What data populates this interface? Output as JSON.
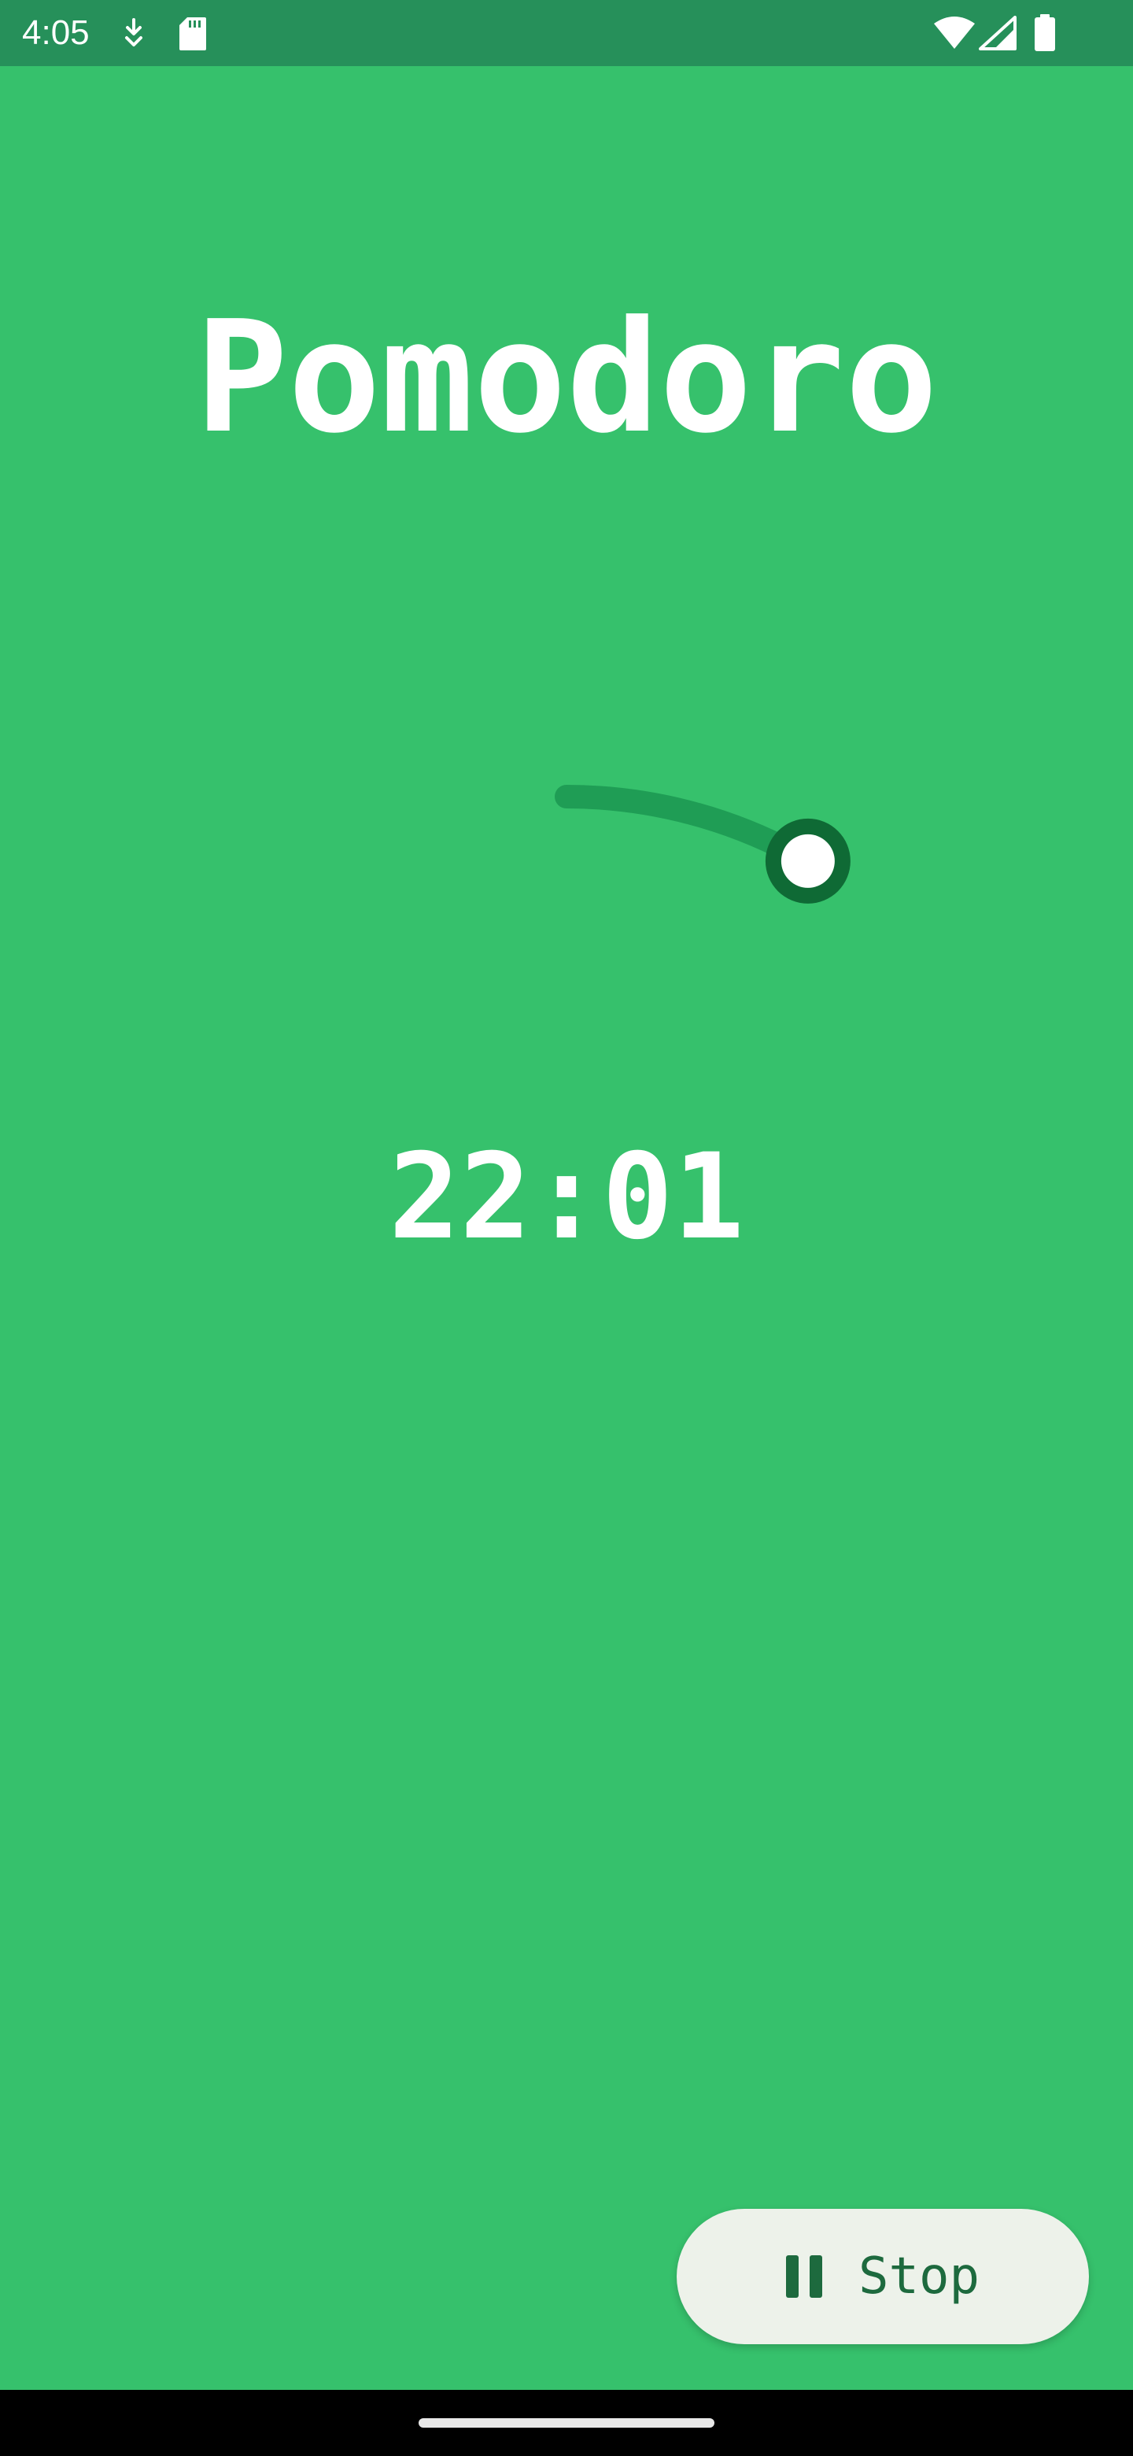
{
  "status_bar": {
    "time": "4:05",
    "icons": [
      "download-icon",
      "sd-card-icon",
      "wifi-icon",
      "signal-icon",
      "battery-icon"
    ]
  },
  "app": {
    "title": "Pomodoro",
    "time_remaining": "22:01",
    "progress_fraction": 0.083
  },
  "controls": {
    "stop_label": "Stop",
    "stop_icon": "pause-icon"
  },
  "colors": {
    "background": "#36c16c",
    "status_bar": "#26905a",
    "arc": "#1f9d55",
    "knob_ring": "#0f6a35",
    "knob_fill": "#ffffff",
    "button_bg": "#edf2ea",
    "button_fg": "#1d6a3e"
  }
}
